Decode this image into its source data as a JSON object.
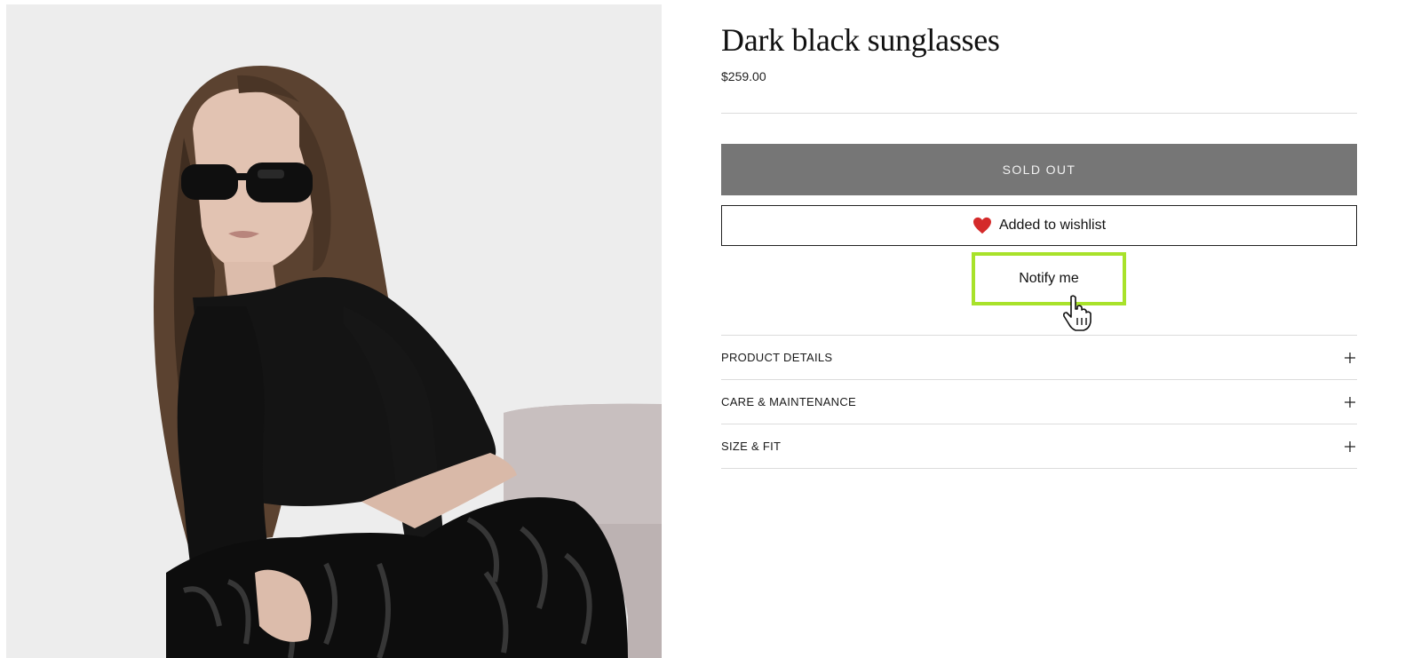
{
  "product": {
    "title": "Dark black sunglasses",
    "price": "$259.00",
    "image_alt": "Model wearing dark black sunglasses"
  },
  "actions": {
    "sold_out_label": "SOLD OUT",
    "wishlist_label": "Added to wishlist",
    "notify_label": "Notify me"
  },
  "accordions": [
    {
      "label": "PRODUCT DETAILS"
    },
    {
      "label": "CARE & MAINTENANCE"
    },
    {
      "label": "SIZE & FIT"
    }
  ],
  "icons": {
    "wishlist": "heart-icon",
    "accordion_toggle": "plus-icon",
    "pointer": "hand-cursor-icon"
  },
  "colors": {
    "sold_out_bg": "#767676",
    "heart": "#d42a2a",
    "notify_highlight": "#a8e22a",
    "image_bg": "#ededed"
  }
}
